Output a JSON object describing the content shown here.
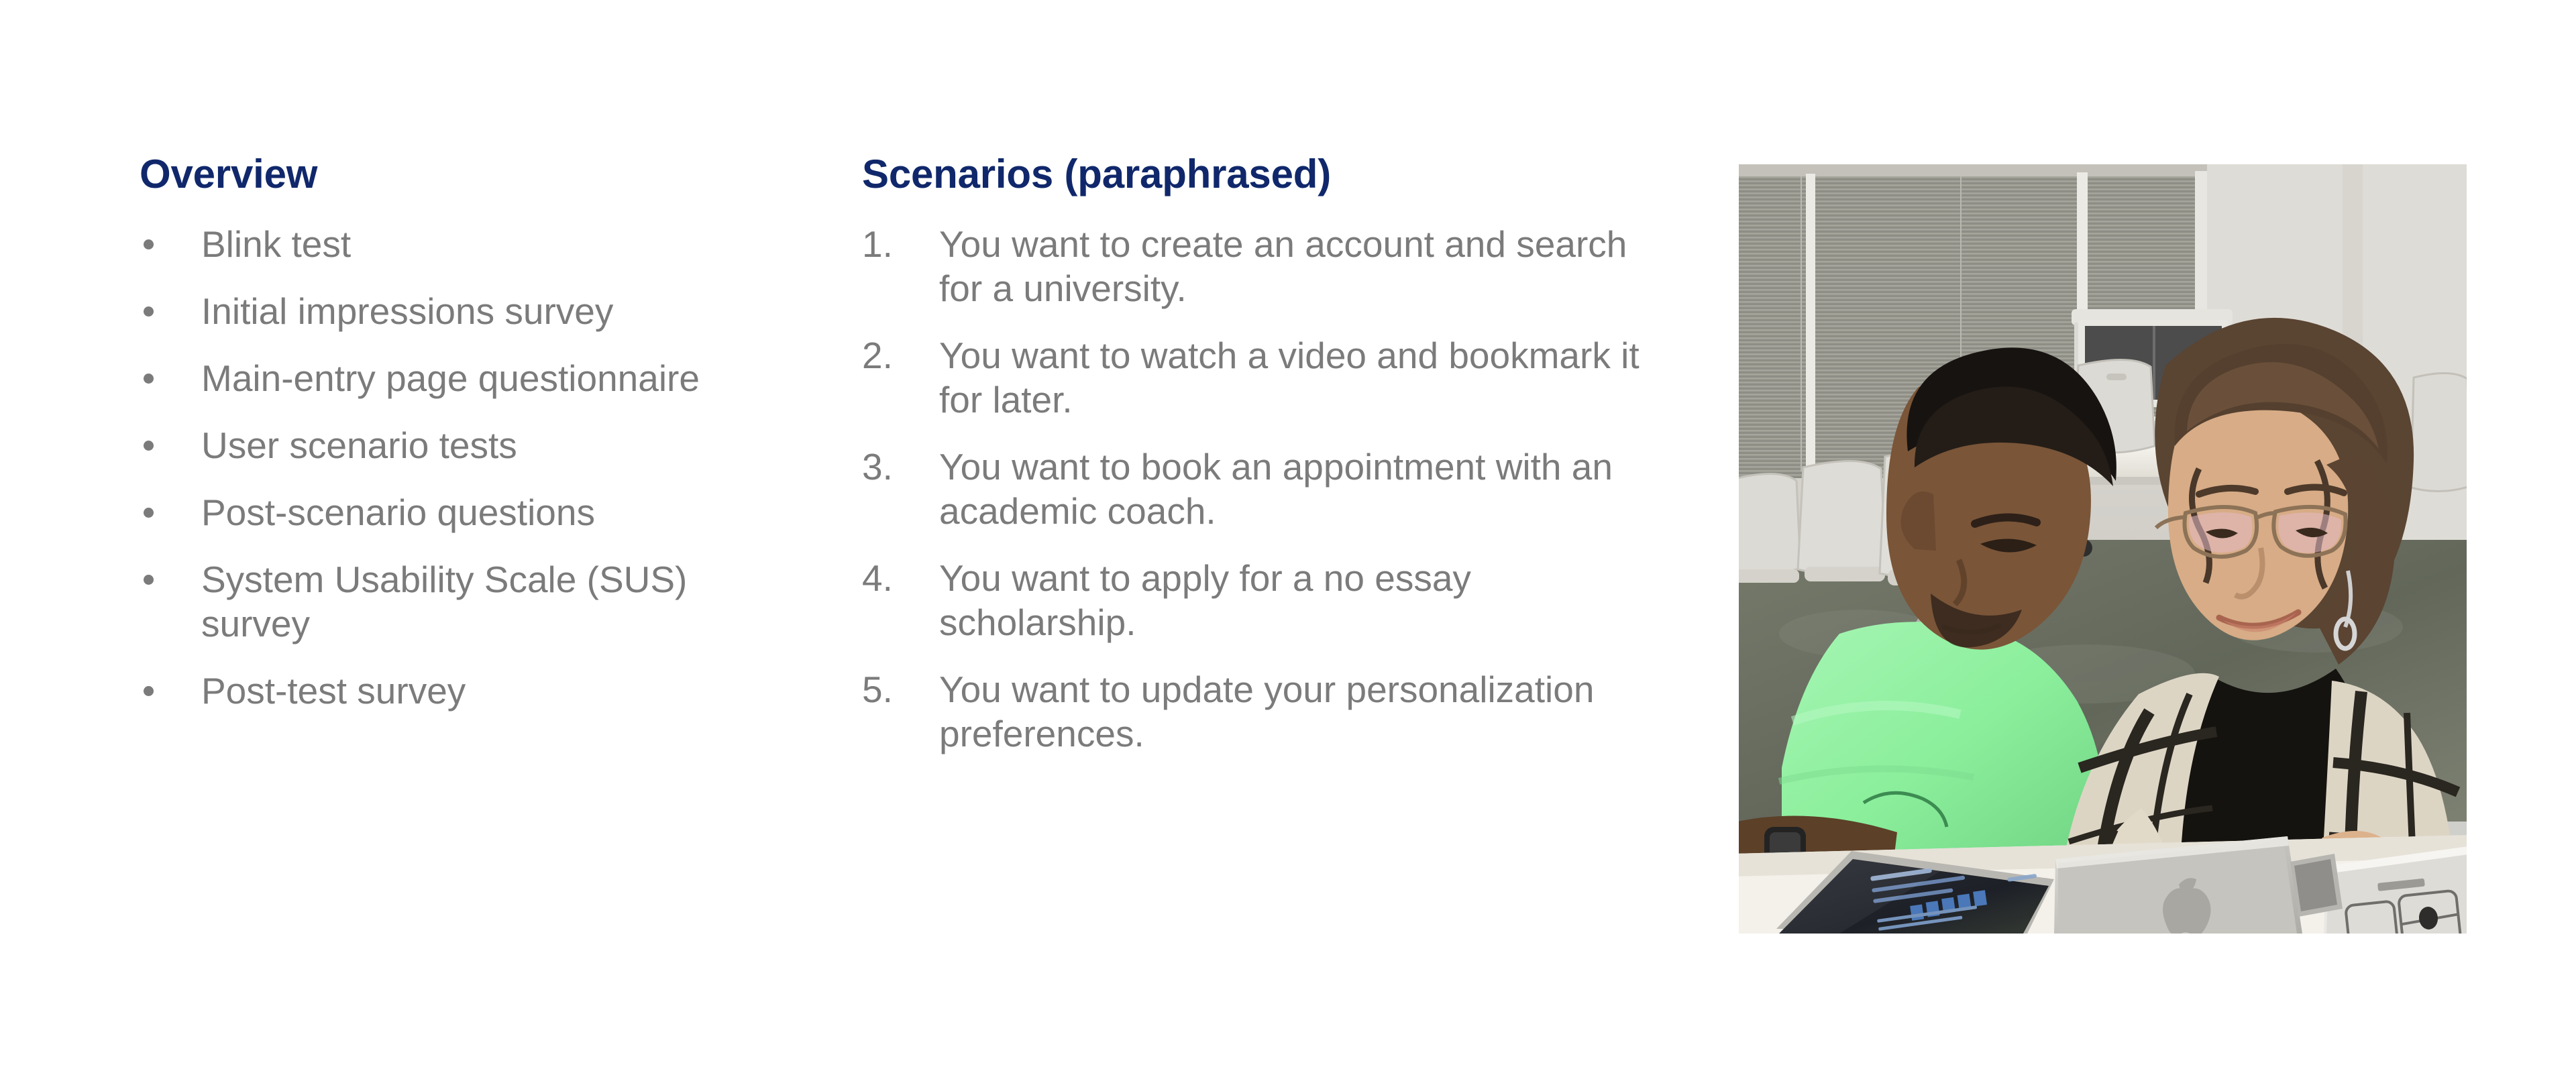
{
  "slide": {
    "background_color": "#ffffff",
    "heading_color": "#10286B",
    "body_text_color": "#7B7B7B"
  },
  "overview": {
    "heading": "Overview",
    "items": [
      "Blink test",
      "Initial impressions survey",
      "Main-entry page questionnaire",
      "User scenario tests",
      "Post-scenario questions",
      "System Usability Scale (SUS) survey",
      "Post-test survey"
    ]
  },
  "scenarios": {
    "heading": "Scenarios (paraphrased)",
    "items": [
      {
        "number": "1.",
        "text": "You want to create an account and search for a university."
      },
      {
        "number": "2.",
        "text": "You want to watch a video and bookmark it for later."
      },
      {
        "number": "3.",
        "text": "You want to book an appointment with an academic coach."
      },
      {
        "number": "4.",
        "text": "You want to apply for a no essay scholarship."
      },
      {
        "number": "5.",
        "text": "You want to update your personalization preferences."
      }
    ]
  },
  "photo": {
    "alt": "Two students sitting at a table in a classroom working on laptops during a usability test session",
    "colors": {
      "wall": "#d9d7d2",
      "blinds": "#8e8e88",
      "carpet": "#6f7266",
      "table": "#f2efe9",
      "green_shirt": "#8ef0a0",
      "plaid_light": "#ded6c4",
      "plaid_dark": "#2a2620",
      "dark_screen": "#23262c",
      "laptop_silver": "#c9c9c5"
    }
  }
}
